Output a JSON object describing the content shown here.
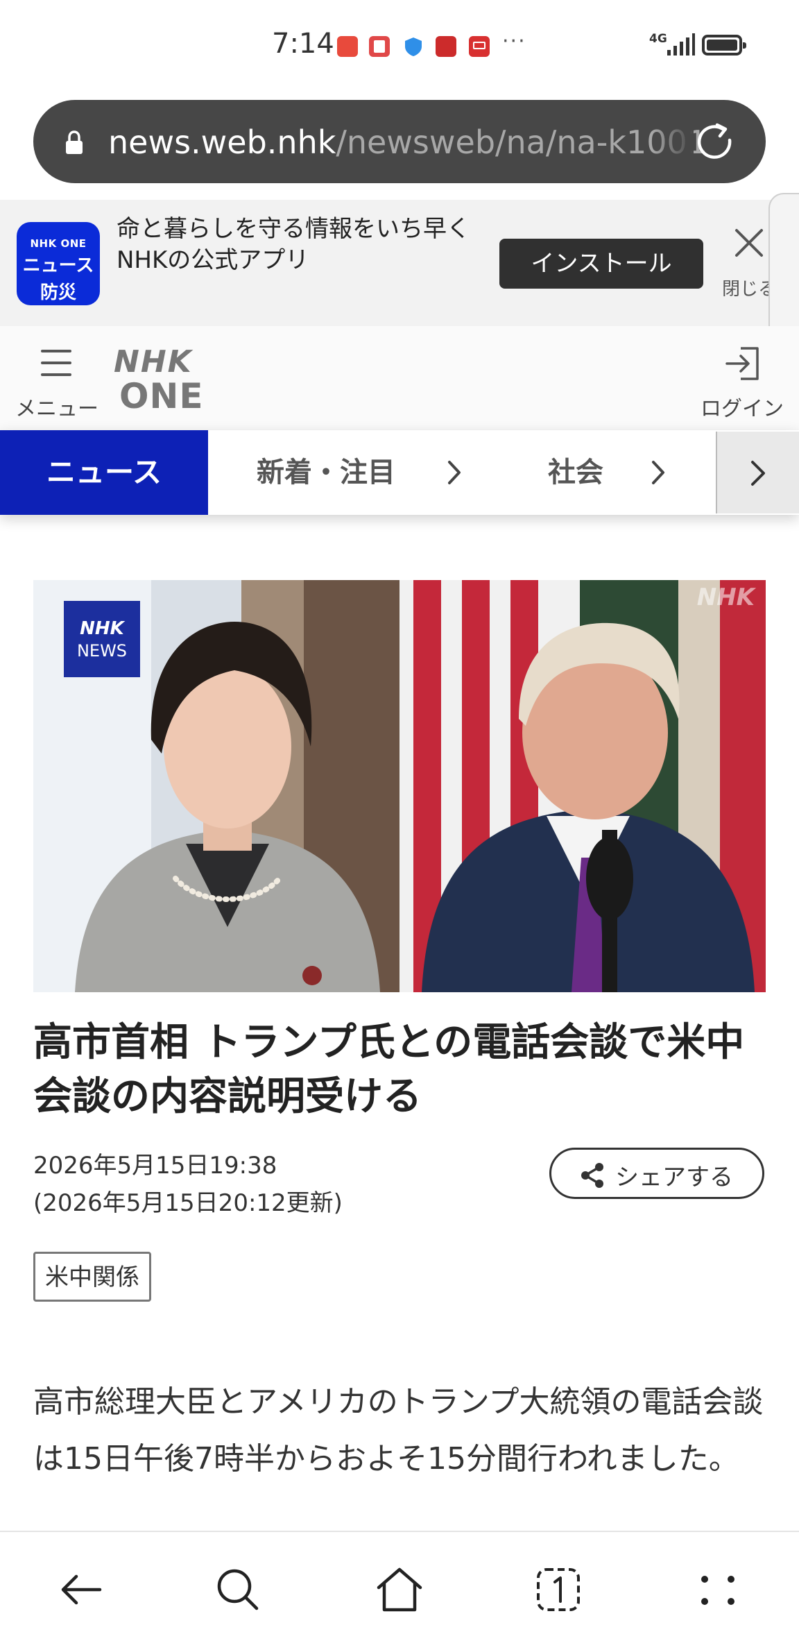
{
  "status_bar": {
    "time": "7:14",
    "more_notifications": "···",
    "network": "4G",
    "notification_icons": [
      "huawei-app-icon",
      "red-app-icon",
      "shield-icon",
      "study-app-icon",
      "tv-app-icon"
    ]
  },
  "browser": {
    "url_host": "news.web.nhk",
    "url_path": "/newsweb/na/na-k1001"
  },
  "app_banner": {
    "app_icon_line1": "NHK ONE",
    "app_icon_line2": "ニュース",
    "app_icon_line3": "防災",
    "line1": "命と暮らしを守る情報をいち早く",
    "line2": "NHKの公式アプリ",
    "install_label": "インストール",
    "close_label": "閉じる"
  },
  "header": {
    "menu_label": "メニュー",
    "logo_top": "NHK",
    "logo_bottom": "ONE",
    "login_label": "ログイン"
  },
  "nav": {
    "active": "ニュース",
    "items": [
      "新着・注目",
      "社会"
    ]
  },
  "article": {
    "image_badge_top": "NHK",
    "image_badge_bottom": "NEWS",
    "image_watermark": "NHK",
    "title": "高市首相 トランプ氏との電話会談で米中会談の内容説明受ける",
    "published": "2026年5月15日19:38",
    "updated": "(2026年5月15日20:12更新)",
    "share_label": "シェアする",
    "tag": "米中関係",
    "body": "高市総理大臣とアメリカのトランプ大統領の電話会談は15日午後7時半からおよそ15分間行われました。"
  },
  "colors": {
    "nhk_blue": "#0d21b6",
    "url_bar": "#474747",
    "app_icon": "#0b2bd8"
  }
}
